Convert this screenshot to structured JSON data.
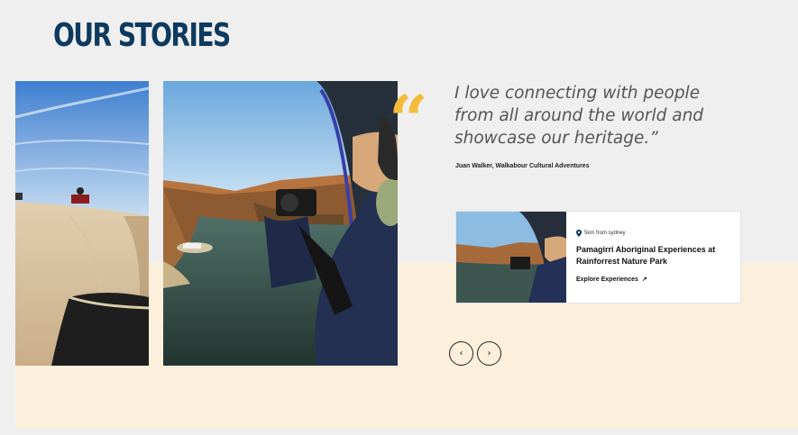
{
  "page": {
    "title": "OUR STORIES"
  },
  "quote": {
    "mark": "“",
    "text": "I love connecting with people from all around the world and showcase our heritage.”",
    "attribution": "Juan Walker, Walkabour Cultural Adventures"
  },
  "story_card": {
    "distance": "5km from sydney",
    "title": "Pamagirri Aboriginal Experiences at Rainforrest Nature Park",
    "link_label": "Explore Experiences",
    "link_icon": "arrow-up-right-icon"
  },
  "carousel": {
    "prev_label": "‹",
    "next_label": "›"
  },
  "colors": {
    "title": "#0d3a5e",
    "quote_mark": "#f4bb3a",
    "cream": "#fcf0dc",
    "background": "#efefef"
  }
}
